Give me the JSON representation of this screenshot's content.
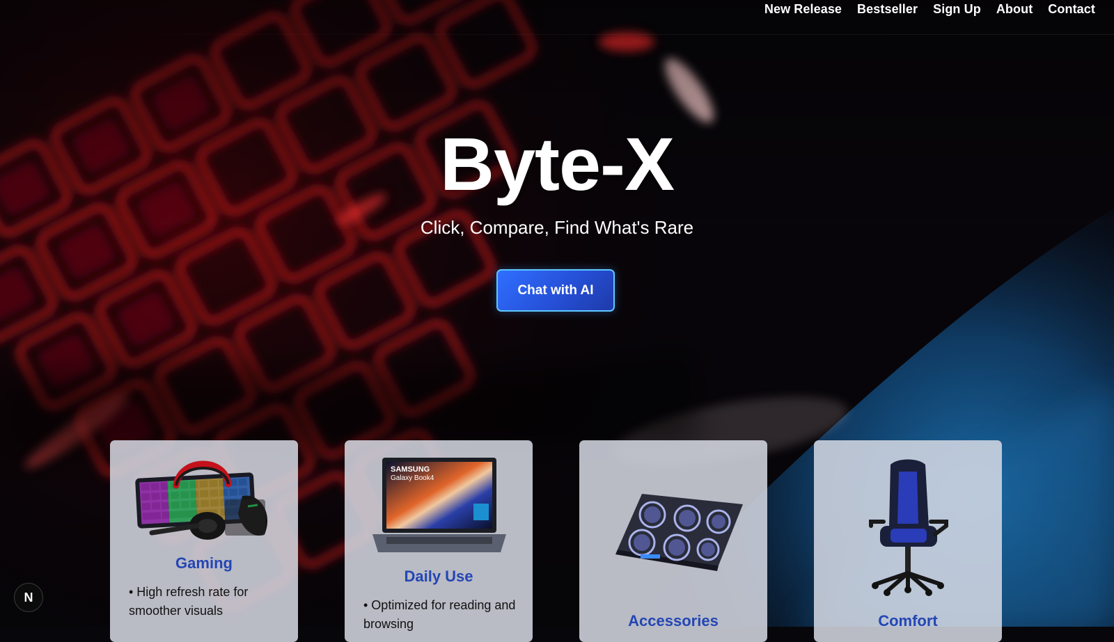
{
  "nav": {
    "items": [
      {
        "label": "New Release"
      },
      {
        "label": "Bestseller"
      },
      {
        "label": "Sign Up"
      },
      {
        "label": "About"
      },
      {
        "label": "Contact"
      }
    ]
  },
  "hero": {
    "title": "Byte-X",
    "tagline": "Click, Compare, Find What's Rare",
    "cta_label": "Chat with AI"
  },
  "cards": [
    {
      "title": "Gaming",
      "desc": "• High refresh rate for smoother visuals",
      "image": "gaming-keyboard-mouse-headset"
    },
    {
      "title": "Daily Use",
      "desc": "• Optimized for reading and browsing",
      "image": "laptop",
      "laptop_brand": "SAMSUNG",
      "laptop_model": "Galaxy Book4"
    },
    {
      "title": "Accessories",
      "desc": "",
      "image": "laptop-cooling-pad"
    },
    {
      "title": "Comfort",
      "desc": "",
      "image": "gaming-chair"
    }
  ],
  "badge": {
    "label": "N"
  },
  "colors": {
    "accent": "#2650d8",
    "cta_border": "#5ec8ff",
    "card_title": "#2446b4",
    "background_red": "#c8111b",
    "background_blue": "#1a5f9e"
  }
}
